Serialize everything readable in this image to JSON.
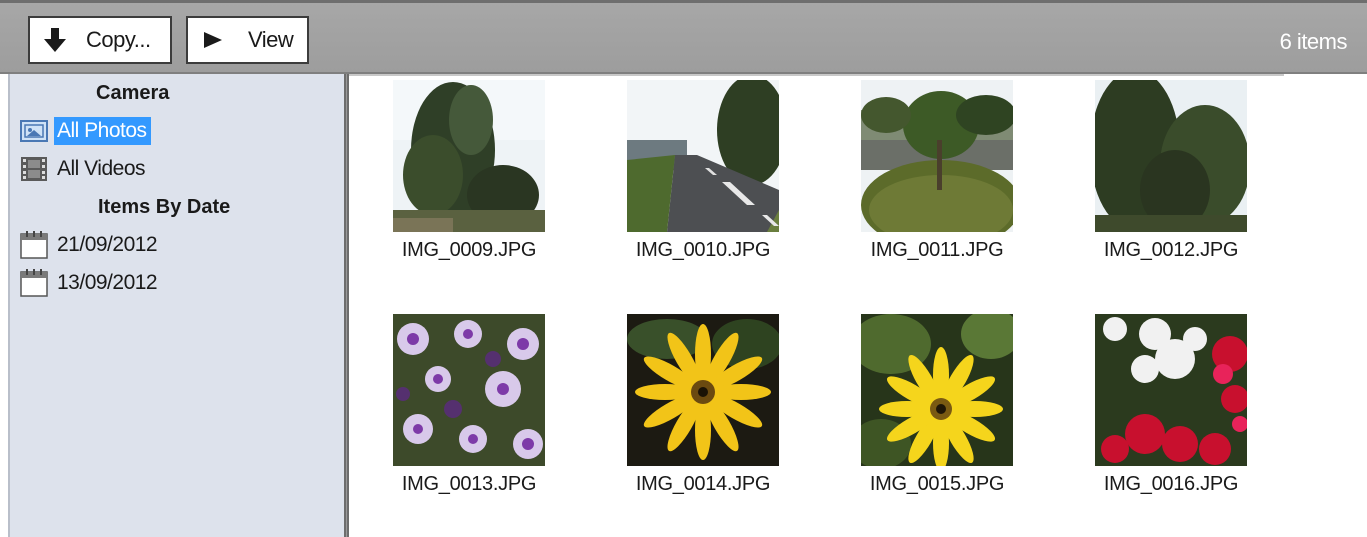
{
  "toolbar": {
    "copy_label": "Copy...",
    "view_label": "View",
    "item_count": "6 items",
    "copy_icon": "arrow-down-icon",
    "view_icon": "play-icon"
  },
  "sidebar": {
    "heading_camera": "Camera",
    "all_photos": "All Photos",
    "all_videos": "All Videos",
    "heading_dates": "Items By Date",
    "dates": [
      "21/09/2012",
      "13/09/2012"
    ]
  },
  "thumbnails": [
    {
      "name": "IMG_0009.JPG"
    },
    {
      "name": "IMG_0010.JPG"
    },
    {
      "name": "IMG_0011.JPG"
    },
    {
      "name": "IMG_0012.JPG"
    },
    {
      "name": "IMG_0013.JPG"
    },
    {
      "name": "IMG_0014.JPG"
    },
    {
      "name": "IMG_0015.JPG"
    },
    {
      "name": "IMG_0016.JPG"
    }
  ],
  "colors": {
    "toolbar_bg": "#a3a3a3",
    "sidebar_bg": "#dde2ec",
    "selection": "#3399ff"
  }
}
